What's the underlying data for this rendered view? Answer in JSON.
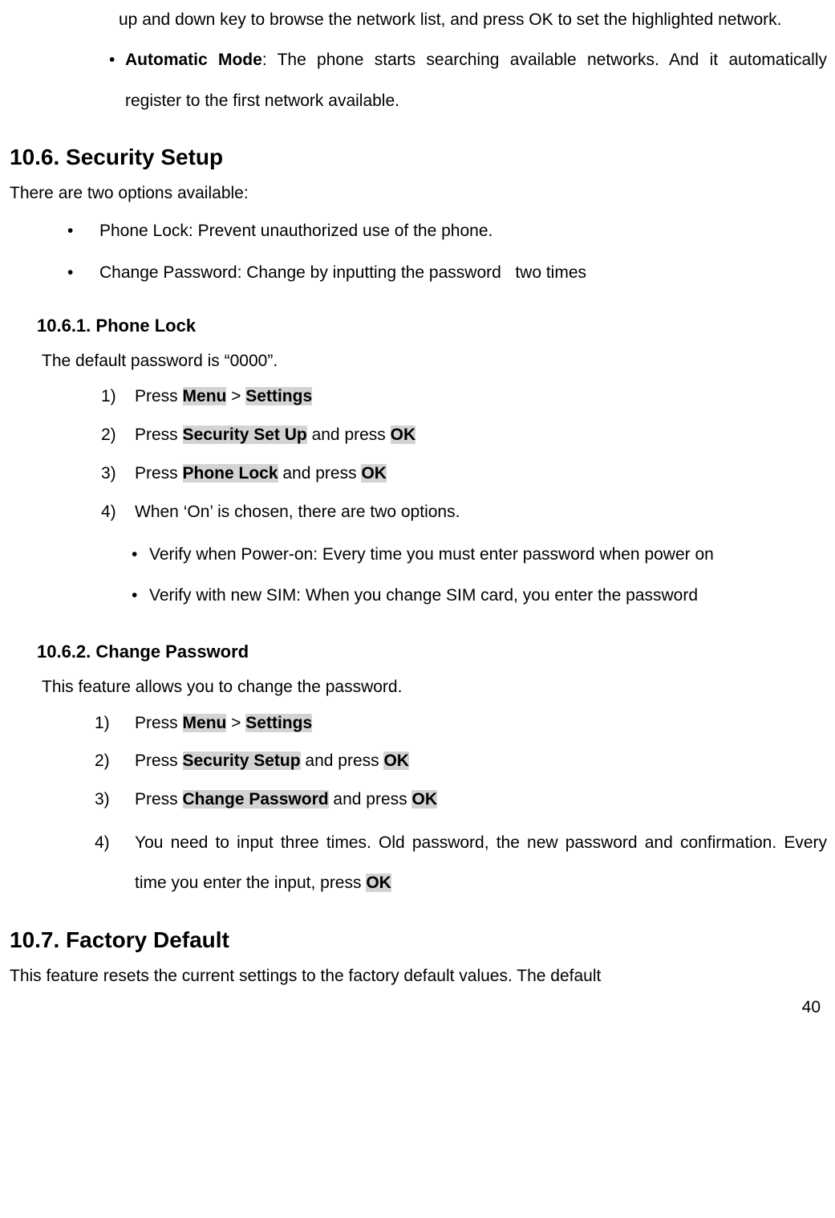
{
  "intro": {
    "continuation": "up and down key to browse the network list, and press OK to set the highlighted network.",
    "auto_mode_label": "Automatic Mode",
    "auto_mode_text": ": The phone starts searching available networks. And it automatically register to the first network available."
  },
  "sec106": {
    "heading": "10.6. Security Setup",
    "intro": "There are two options available:",
    "opt1": "Phone Lock: Prevent unauthorized use of the phone.",
    "opt2": "Change Password: Change by inputting the password   two times"
  },
  "sec1061": {
    "heading": "10.6.1. Phone Lock",
    "intro": "The default password is “0000”.",
    "s1_num": "1)",
    "s1_a": "Press ",
    "s1_menu": "Menu",
    "s1_gt": " > ",
    "s1_settings": "Settings",
    "s2_num": "2)",
    "s2_a": "Press ",
    "s2_sec": "Security Set Up",
    "s2_b": " and press ",
    "s2_ok": "OK",
    "s3_num": "3)",
    "s3_a": "Press ",
    "s3_lock": "Phone Lock",
    "s3_b": " and press ",
    "s3_ok": "OK",
    "s4_num": "4)",
    "s4_text": "When ‘On’ is chosen, there are two options.",
    "sub1": "Verify when Power-on: Every time you must enter password when power on",
    "sub2": "Verify with new SIM: When you change SIM card, you enter the password"
  },
  "sec1062": {
    "heading": "10.6.2. Change Password",
    "intro": "This feature allows you to change the password.",
    "s1_num": "1)",
    "s1_a": "Press ",
    "s1_menu": "Menu",
    "s1_gt": " > ",
    "s1_settings": "Settings",
    "s2_num": "2)",
    "s2_a": "Press ",
    "s2_sec": "Security Setup",
    "s2_b": " and press ",
    "s2_ok": "OK",
    "s3_num": "3)",
    "s3_a": "Press ",
    "s3_cp": "Change Password",
    "s3_b": " and press ",
    "s3_ok": "OK",
    "s4_num": "4)",
    "s4_a": "You need to input three times. Old password, the new password and confirmation. Every time you enter the input, press ",
    "s4_ok": "OK"
  },
  "sec107": {
    "heading": "10.7. Factory Default",
    "intro": "This feature resets the current settings to the factory default values. The default"
  },
  "page_number": "40"
}
